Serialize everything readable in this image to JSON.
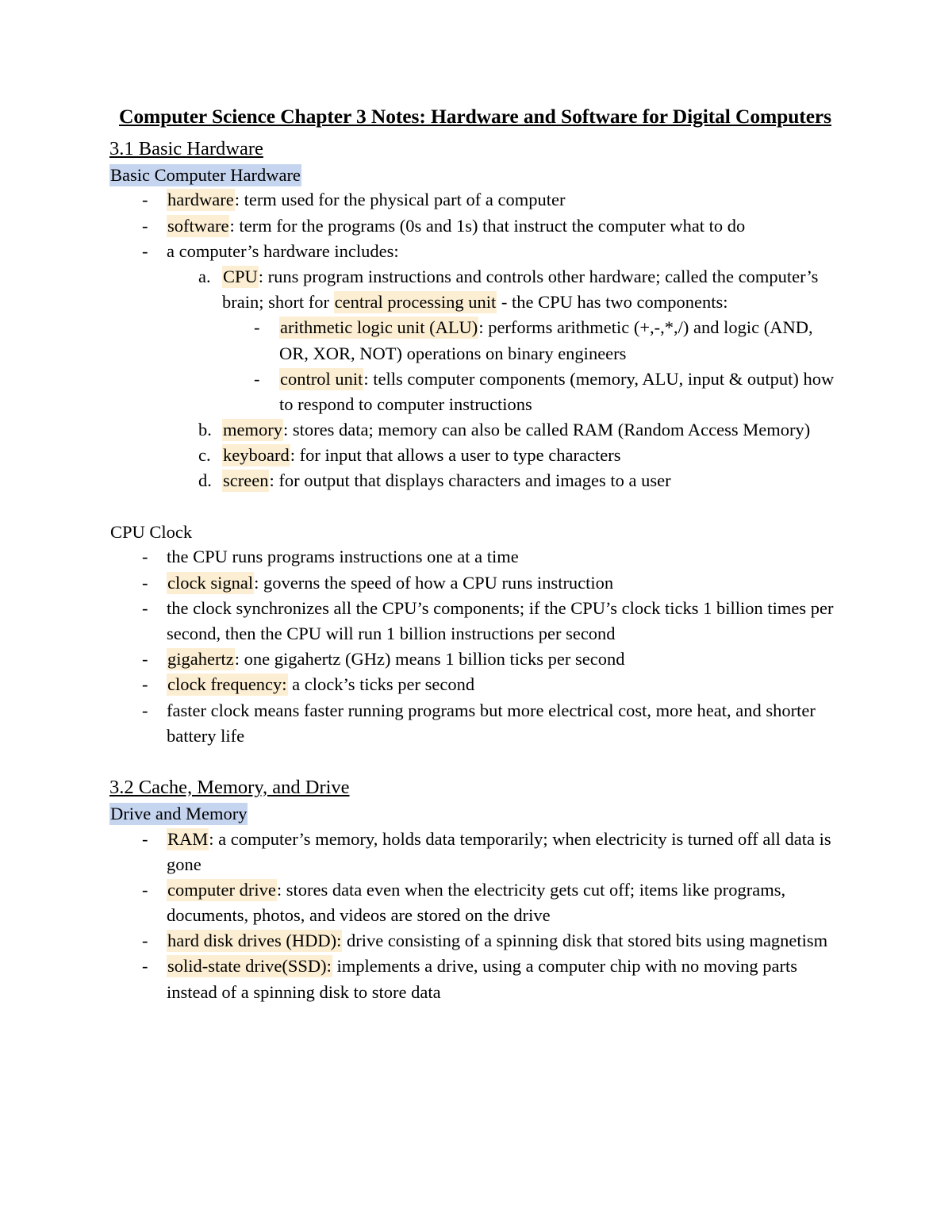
{
  "document": {
    "title": "Computer Science Chapter 3 Notes: Hardware and Software for Digital Computers"
  },
  "sections": [
    {
      "heading": "3.1 Basic Hardware",
      "groups": [
        {
          "subheading": "Basic Computer Hardware",
          "subheading_style": "blue",
          "items": [
            {
              "term": "hardware",
              "rest": ": term used for the physical part of a computer"
            },
            {
              "term": "software",
              "rest": ": term for the programs (0s and 1s) that instruct the computer what to do"
            },
            {
              "term": "",
              "rest": "a computer’s hardware includes:",
              "sub": {
                "type": "alpha",
                "items": [
                  {
                    "marker": "a.",
                    "term": "CPU",
                    "rest_a": ": runs program instructions and controls other hardware; called the computer’s brain; short for ",
                    "term2": "central processing unit",
                    "rest_b": " - the CPU has two components:",
                    "sub": {
                      "type": "dash",
                      "items": [
                        {
                          "term": "arithmetic logic unit (ALU)",
                          "rest": ": performs arithmetic (+,-,*,/) and logic (AND, OR, XOR, NOT) operations on binary engineers"
                        },
                        {
                          "term": "control unit",
                          "rest": ": tells computer components (memory, ALU, input & output) how to respond to computer instructions"
                        }
                      ]
                    }
                  },
                  {
                    "marker": "b.",
                    "term": "memory",
                    "rest_a": ": stores data; memory can also be called RAM (Random Access Memory)"
                  },
                  {
                    "marker": "c.",
                    "term": "keyboard",
                    "rest_a": ": for input that allows a user to type characters"
                  },
                  {
                    "marker": "d.",
                    "term": "screen",
                    "rest_a": ": for output that displays characters and images to a user"
                  }
                ]
              }
            }
          ]
        },
        {
          "subheading": "CPU Clock",
          "subheading_style": "plain",
          "items": [
            {
              "term": "",
              "rest": "the CPU runs programs instructions one at a time"
            },
            {
              "term": "clock signal",
              "rest": ": governs the speed of how a CPU runs instruction"
            },
            {
              "term": "",
              "rest": "the clock synchronizes all the CPU’s components; if the CPU’s clock ticks 1 billion times per second, then the CPU will run 1 billion instructions per second"
            },
            {
              "term": "gigahertz",
              "rest": ": one gigahertz (GHz) means 1 billion ticks per second"
            },
            {
              "term": "clock frequency:",
              "rest": " a clock’s ticks per second"
            },
            {
              "term": "",
              "rest": "faster clock means faster running programs but more electrical cost, more heat, and shorter battery life"
            }
          ]
        }
      ]
    },
    {
      "heading": "3.2 Cache, Memory, and Drive",
      "groups": [
        {
          "subheading": "Drive and Memory",
          "subheading_style": "blue",
          "items": [
            {
              "term": "RAM",
              "rest": ": a computer’s memory, holds data temporarily; when electricity is turned off all data is gone"
            },
            {
              "term": "computer drive",
              "rest": ": stores data even when the electricity gets cut off; items like programs, documents, photos, and videos are stored on the drive"
            },
            {
              "term": "hard disk drives (HDD):",
              "rest": " drive consisting of a spinning disk that stored bits using magnetism"
            },
            {
              "term": "solid-state drive(SSD):",
              "rest": " implements a drive, using a computer chip with no moving parts instead of a spinning disk to store data"
            }
          ]
        }
      ]
    }
  ],
  "markers": {
    "dash": "-"
  },
  "colors": {
    "highlight_yellow": "#fceed2",
    "highlight_blue": "#c6d5ef",
    "text": "#000000",
    "page_background": "#ffffff"
  }
}
